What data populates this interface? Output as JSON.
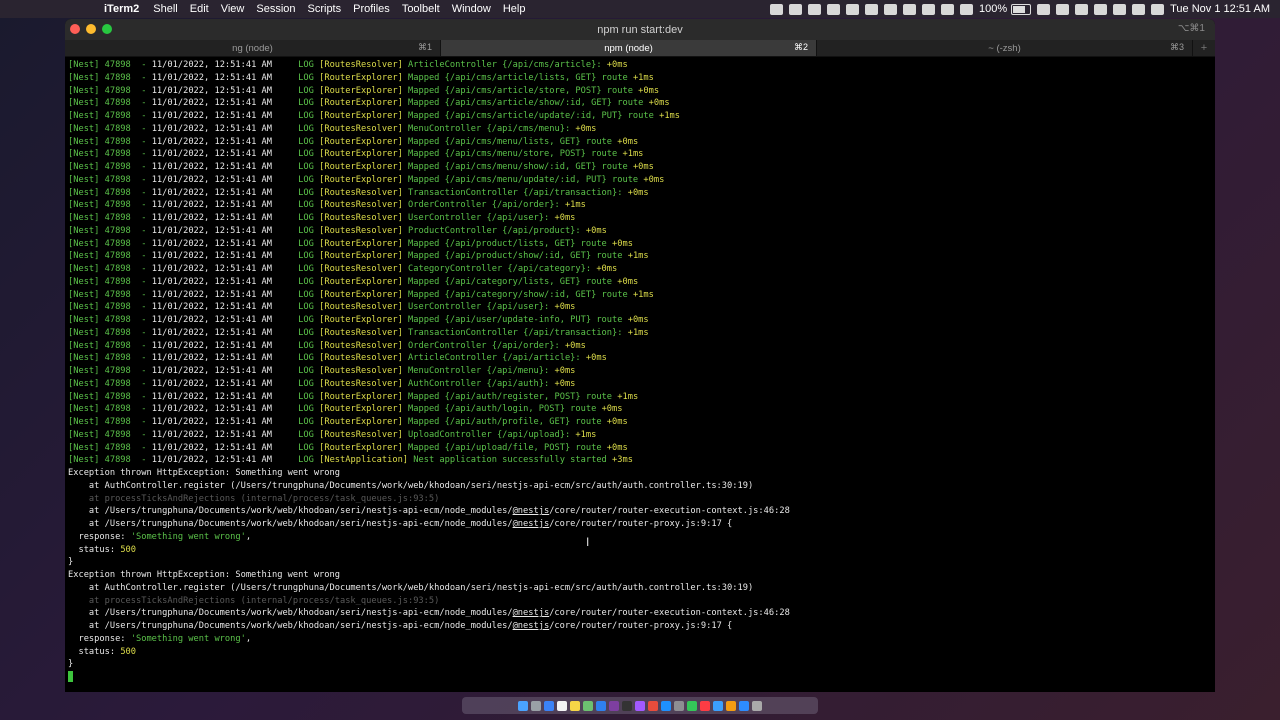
{
  "menubar": {
    "apple_icon": "apple-icon",
    "app_name": "iTerm2",
    "menus": [
      "Shell",
      "Edit",
      "View",
      "Session",
      "Scripts",
      "Profiles",
      "Toolbelt",
      "Window",
      "Help"
    ],
    "battery": "100%",
    "datetime": "Tue Nov 1  12:51 AM"
  },
  "window": {
    "title": "npm run start:dev",
    "title_shortcut": "⌥⌘1",
    "tabs": [
      {
        "label": "ng (node)",
        "key": "⌘1"
      },
      {
        "label": "npm (node)",
        "key": "⌘2"
      },
      {
        "label": "~ (-zsh)",
        "key": "⌘3"
      }
    ],
    "add_tab": "+"
  },
  "log": {
    "prefix": "[Nest] 47898  -",
    "timestamp": "11/01/2022, 12:51:41 AM",
    "level": "LOG",
    "entries": [
      {
        "ctx": "[RoutesResolver]",
        "msg": "ArticleController {/api/cms/article}:",
        "time": "+0ms"
      },
      {
        "ctx": "[RouterExplorer]",
        "msg": "Mapped {/api/cms/article/lists, GET} route",
        "time": "+1ms"
      },
      {
        "ctx": "[RouterExplorer]",
        "msg": "Mapped {/api/cms/article/store, POST} route",
        "time": "+0ms"
      },
      {
        "ctx": "[RouterExplorer]",
        "msg": "Mapped {/api/cms/article/show/:id, GET} route",
        "time": "+0ms"
      },
      {
        "ctx": "[RouterExplorer]",
        "msg": "Mapped {/api/cms/article/update/:id, PUT} route",
        "time": "+1ms"
      },
      {
        "ctx": "[RoutesResolver]",
        "msg": "MenuController {/api/cms/menu}:",
        "time": "+0ms"
      },
      {
        "ctx": "[RouterExplorer]",
        "msg": "Mapped {/api/cms/menu/lists, GET} route",
        "time": "+0ms"
      },
      {
        "ctx": "[RouterExplorer]",
        "msg": "Mapped {/api/cms/menu/store, POST} route",
        "time": "+1ms"
      },
      {
        "ctx": "[RouterExplorer]",
        "msg": "Mapped {/api/cms/menu/show/:id, GET} route",
        "time": "+0ms"
      },
      {
        "ctx": "[RouterExplorer]",
        "msg": "Mapped {/api/cms/menu/update/:id, PUT} route",
        "time": "+0ms"
      },
      {
        "ctx": "[RoutesResolver]",
        "msg": "TransactionController {/api/transaction}:",
        "time": "+0ms"
      },
      {
        "ctx": "[RoutesResolver]",
        "msg": "OrderController {/api/order}:",
        "time": "+1ms"
      },
      {
        "ctx": "[RoutesResolver]",
        "msg": "UserController {/api/user}:",
        "time": "+0ms"
      },
      {
        "ctx": "[RoutesResolver]",
        "msg": "ProductController {/api/product}:",
        "time": "+0ms"
      },
      {
        "ctx": "[RouterExplorer]",
        "msg": "Mapped {/api/product/lists, GET} route",
        "time": "+0ms"
      },
      {
        "ctx": "[RouterExplorer]",
        "msg": "Mapped {/api/product/show/:id, GET} route",
        "time": "+1ms"
      },
      {
        "ctx": "[RoutesResolver]",
        "msg": "CategoryController {/api/category}:",
        "time": "+0ms"
      },
      {
        "ctx": "[RouterExplorer]",
        "msg": "Mapped {/api/category/lists, GET} route",
        "time": "+0ms"
      },
      {
        "ctx": "[RouterExplorer]",
        "msg": "Mapped {/api/category/show/:id, GET} route",
        "time": "+1ms"
      },
      {
        "ctx": "[RoutesResolver]",
        "msg": "UserController {/api/user}:",
        "time": "+0ms"
      },
      {
        "ctx": "[RouterExplorer]",
        "msg": "Mapped {/api/user/update-info, PUT} route",
        "time": "+0ms"
      },
      {
        "ctx": "[RoutesResolver]",
        "msg": "TransactionController {/api/transaction}:",
        "time": "+1ms"
      },
      {
        "ctx": "[RoutesResolver]",
        "msg": "OrderController {/api/order}:",
        "time": "+0ms"
      },
      {
        "ctx": "[RoutesResolver]",
        "msg": "ArticleController {/api/article}:",
        "time": "+0ms"
      },
      {
        "ctx": "[RoutesResolver]",
        "msg": "MenuController {/api/menu}:",
        "time": "+0ms"
      },
      {
        "ctx": "[RoutesResolver]",
        "msg": "AuthController {/api/auth}:",
        "time": "+0ms"
      },
      {
        "ctx": "[RouterExplorer]",
        "msg": "Mapped {/api/auth/register, POST} route",
        "time": "+1ms"
      },
      {
        "ctx": "[RouterExplorer]",
        "msg": "Mapped {/api/auth/login, POST} route",
        "time": "+0ms"
      },
      {
        "ctx": "[RouterExplorer]",
        "msg": "Mapped {/api/auth/profile, GET} route",
        "time": "+0ms"
      },
      {
        "ctx": "[RoutesResolver]",
        "msg": "UploadController {/api/upload}:",
        "time": "+1ms"
      },
      {
        "ctx": "[RouterExplorer]",
        "msg": "Mapped {/api/upload/file, POST} route",
        "time": "+0ms"
      },
      {
        "ctx": "[NestApplication]",
        "msg": "Nest application successfully started",
        "time": "+3ms"
      }
    ]
  },
  "exceptions": [
    {
      "header": "Exception thrown HttpException: Something went wrong",
      "stack1": "    at AuthController.register (/Users/trungphuna/Documents/work/web/khodoan/seri/nestjs-api-ecm/src/auth/auth.controller.ts:30:19)",
      "stack2": "    at processTicksAndRejections (internal/process/task_queues.js:93:5)",
      "stack3_pre": "    at /Users/trungphuna/Documents/work/web/khodoan/seri/nestjs-api-ecm/node_modules/",
      "stack3_link": "@nestjs",
      "stack3_post": "/core/router/router-execution-context.js:46:28",
      "stack4_pre": "    at /Users/trungphuna/Documents/work/web/khodoan/seri/nestjs-api-ecm/node_modules/",
      "stack4_link": "@nestjs",
      "stack4_post": "/core/router/router-proxy.js:9:17 {",
      "response_key": "  response: ",
      "response_val": "'Something went wrong'",
      "response_comma": ",",
      "status_key": "  status: ",
      "status_val": "500",
      "close": "}"
    },
    {
      "header": "Exception thrown HttpException: Something went wrong",
      "stack1": "    at AuthController.register (/Users/trungphuna/Documents/work/web/khodoan/seri/nestjs-api-ecm/src/auth/auth.controller.ts:30:19)",
      "stack2": "    at processTicksAndRejections (internal/process/task_queues.js:93:5)",
      "stack3_pre": "    at /Users/trungphuna/Documents/work/web/khodoan/seri/nestjs-api-ecm/node_modules/",
      "stack3_link": "@nestjs",
      "stack3_post": "/core/router/router-execution-context.js:46:28",
      "stack4_pre": "    at /Users/trungphuna/Documents/work/web/khodoan/seri/nestjs-api-ecm/node_modules/",
      "stack4_link": "@nestjs",
      "stack4_post": "/core/router/router-proxy.js:9:17 {",
      "response_key": "  response: ",
      "response_val": "'Something went wrong'",
      "response_comma": ",",
      "status_key": "  status: ",
      "status_val": "500",
      "close": "}"
    }
  ],
  "colors": {
    "log_green": "#5bc24a",
    "log_yellow": "#dcdc4a",
    "dim_gray": "#5a5a5a",
    "cursor": "#3dc43d"
  },
  "dock_icons": [
    "finder-icon",
    "launchpad-icon",
    "safari-icon",
    "calendar-icon",
    "notes-icon",
    "maps-icon",
    "vscode-icon",
    "slack-icon",
    "terminal-icon",
    "figma-icon",
    "chrome-icon",
    "app-store-icon",
    "settings-icon",
    "messages-icon",
    "music-icon",
    "mail-icon",
    "photos-icon",
    "zoom-icon",
    "trash-icon"
  ]
}
